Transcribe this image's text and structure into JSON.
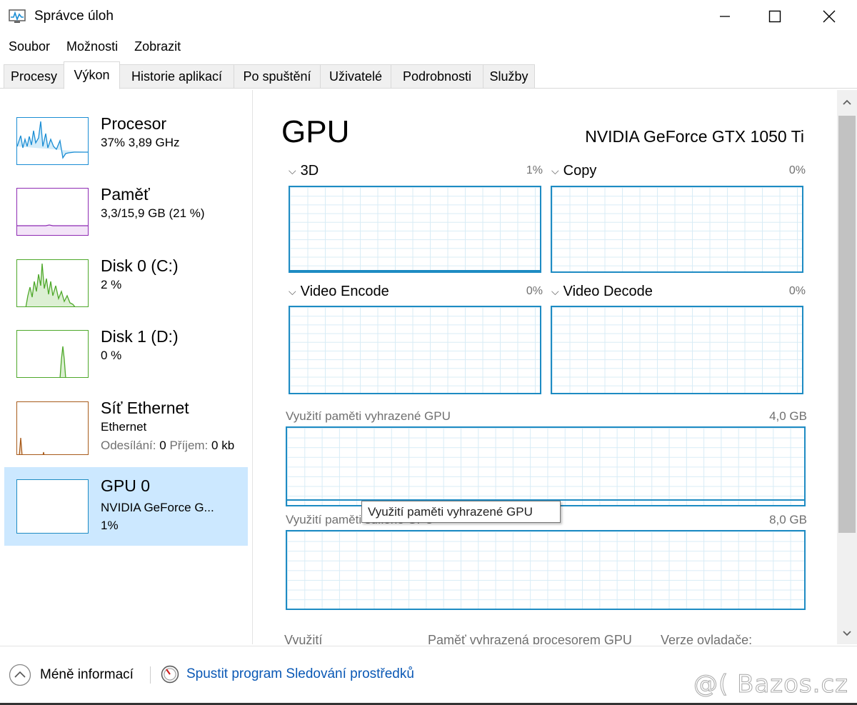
{
  "window": {
    "title": "Správce úloh",
    "minimize_glyph": "—",
    "maximize_glyph": "☐",
    "close_glyph": "✕"
  },
  "menu": [
    "Soubor",
    "Možnosti",
    "Zobrazit"
  ],
  "tabs": [
    "Procesy",
    "Výkon",
    "Historie aplikací",
    "Po spuštění",
    "Uživatelé",
    "Podrobnosti",
    "Služby"
  ],
  "active_tab": "Výkon",
  "sidebar": {
    "items": [
      {
        "title": "Procesor",
        "line1": "37% 3,89 GHz",
        "line2": "",
        "color": "#1a8dd4"
      },
      {
        "title": "Paměť",
        "line1": "3,3/15,9 GB (21 %)",
        "line2": "",
        "color": "#8e2bb3"
      },
      {
        "title": "Disk 0 (C:)",
        "line1": "2 %",
        "line2": "",
        "color": "#4ea82a"
      },
      {
        "title": "Disk 1 (D:)",
        "line1": "0 %",
        "line2": "",
        "color": "#4ea82a"
      },
      {
        "title": "Síť Ethernet",
        "line1": "Ethernet",
        "line2_label_send": "Odesílání:",
        "line2_val_send": "0",
        "line2_label_recv": "Příjem:",
        "line2_val_recv": "0 kb",
        "color": "#a85b1b"
      },
      {
        "title": "GPU 0",
        "line1": "NVIDIA GeForce G...",
        "line2": "1%",
        "color": "#1e8bc3"
      }
    ]
  },
  "main": {
    "heading": "GPU",
    "gpu_name": "NVIDIA GeForce GTX 1050 Ti",
    "engines": [
      {
        "label": "3D",
        "pct": "1%"
      },
      {
        "label": "Copy",
        "pct": "0%"
      },
      {
        "label": "Video Encode",
        "pct": "0%"
      },
      {
        "label": "Video Decode",
        "pct": "0%"
      }
    ],
    "dedicated_label": "Využití paměti vyhrazené GPU",
    "dedicated_max": "4,0 GB",
    "shared_label_partial": "Využití paměti sdílené GPU",
    "shared_max": "8,0 GB",
    "tooltip": "Využití paměti vyhrazené GPU",
    "stat_labels": [
      "Využití",
      "Paměť vyhrazená procesorem GPU",
      "Verze ovladače:"
    ]
  },
  "footer": {
    "less_info": "Méně informací",
    "resource_monitor": "Spustit program Sledování prostředků"
  },
  "watermark": "@( Bazos.cz"
}
